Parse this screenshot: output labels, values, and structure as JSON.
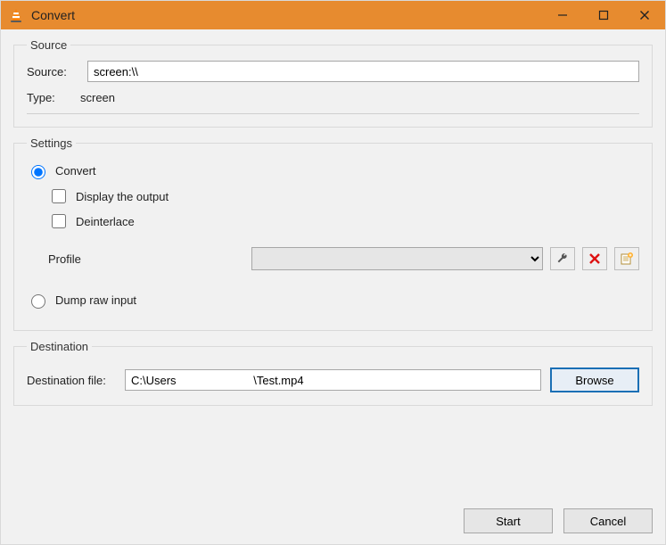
{
  "window": {
    "title": "Convert"
  },
  "source": {
    "legend": "Source",
    "source_label": "Source:",
    "source_value": "screen:\\\\",
    "type_label": "Type:",
    "type_value": "screen"
  },
  "settings": {
    "legend": "Settings",
    "convert_label": "Convert",
    "convert_selected": true,
    "display_output_label": "Display the output",
    "display_output_checked": false,
    "deinterlace_label": "Deinterlace",
    "deinterlace_checked": false,
    "profile_label": "Profile",
    "profile_selected": "",
    "dump_label": "Dump raw input",
    "dump_selected": false,
    "tool_edit": "wrench-icon",
    "tool_delete": "delete-icon",
    "tool_new": "new-profile-icon"
  },
  "destination": {
    "legend": "Destination",
    "file_label": "Destination file:",
    "file_value": "C:\\Users                        \\Test.mp4",
    "browse_label": "Browse"
  },
  "footer": {
    "start_label": "Start",
    "cancel_label": "Cancel"
  }
}
